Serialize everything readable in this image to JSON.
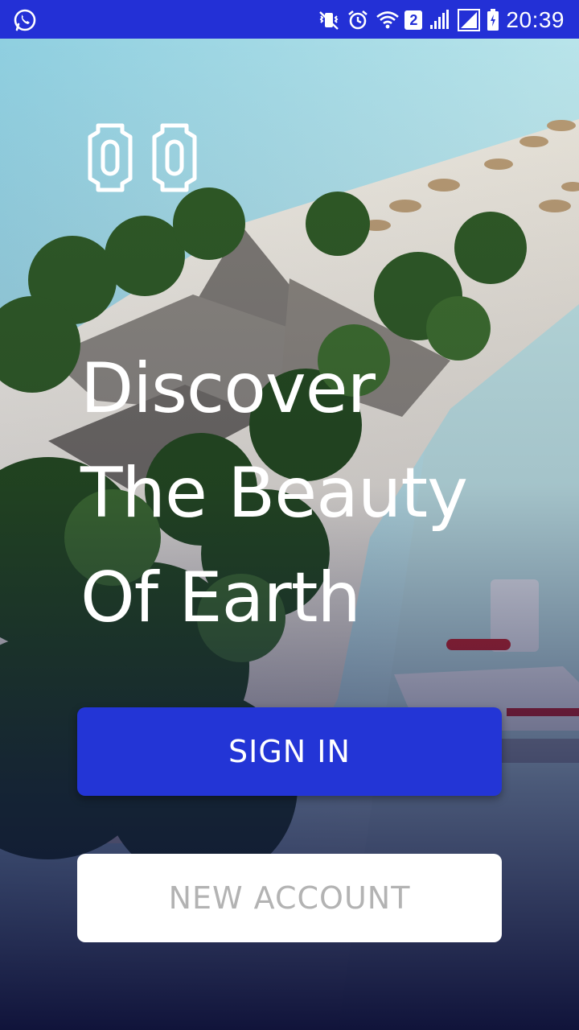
{
  "status_bar": {
    "time": "20:39",
    "sim_badge": "2",
    "bar_color": "#2330d6"
  },
  "logo": {
    "icon": "double-ticket-logo-icon"
  },
  "headline": {
    "lines": [
      "Discover",
      "The Beauty",
      "Of Earth"
    ]
  },
  "actions": {
    "sign_in_label": "SIGN IN",
    "new_account_label": "NEW ACCOUNT",
    "primary_color": "#2335d6"
  }
}
